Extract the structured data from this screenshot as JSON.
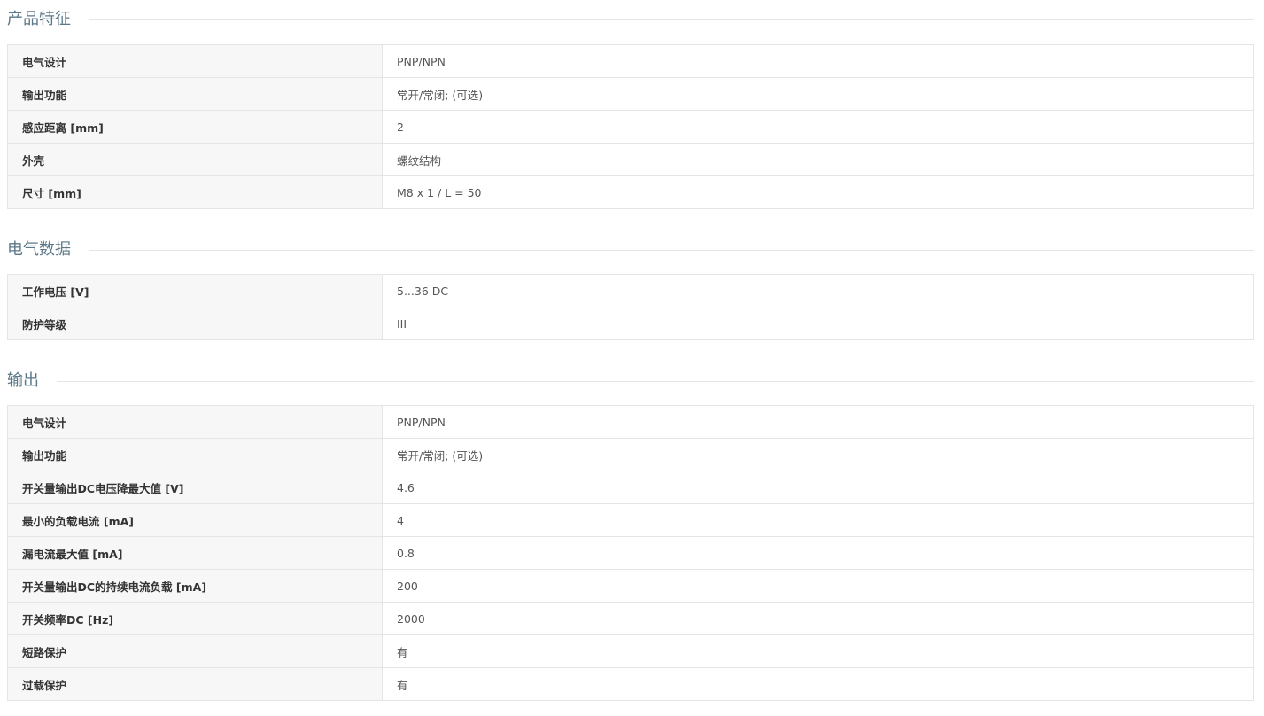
{
  "sections": [
    {
      "title": "产品特征",
      "rows": [
        {
          "label": "电气设计",
          "value": "PNP/NPN"
        },
        {
          "label": "输出功能",
          "value": "常开/常闭; (可选)"
        },
        {
          "label": "感应距离 [mm]",
          "value": "2"
        },
        {
          "label": "外壳",
          "value": "螺纹结构"
        },
        {
          "label": "尺寸 [mm]",
          "value": "M8 x 1 / L = 50"
        }
      ]
    },
    {
      "title": "电气数据",
      "rows": [
        {
          "label": "工作电压 [V]",
          "value": "5...36 DC"
        },
        {
          "label": "防护等级",
          "value": "III"
        }
      ]
    },
    {
      "title": "输出",
      "rows": [
        {
          "label": "电气设计",
          "value": "PNP/NPN"
        },
        {
          "label": "输出功能",
          "value": "常开/常闭; (可选)"
        },
        {
          "label": "开关量输出DC电压降最大值 [V]",
          "value": "4.6"
        },
        {
          "label": "最小的负载电流 [mA]",
          "value": "4"
        },
        {
          "label": "漏电流最大值 [mA]",
          "value": "0.8"
        },
        {
          "label": "开关量输出DC的持续电流负载 [mA]",
          "value": "200"
        },
        {
          "label": "开关频率DC [Hz]",
          "value": "2000"
        },
        {
          "label": "短路保护",
          "value": "有"
        },
        {
          "label": "过载保护",
          "value": "有"
        }
      ]
    }
  ]
}
